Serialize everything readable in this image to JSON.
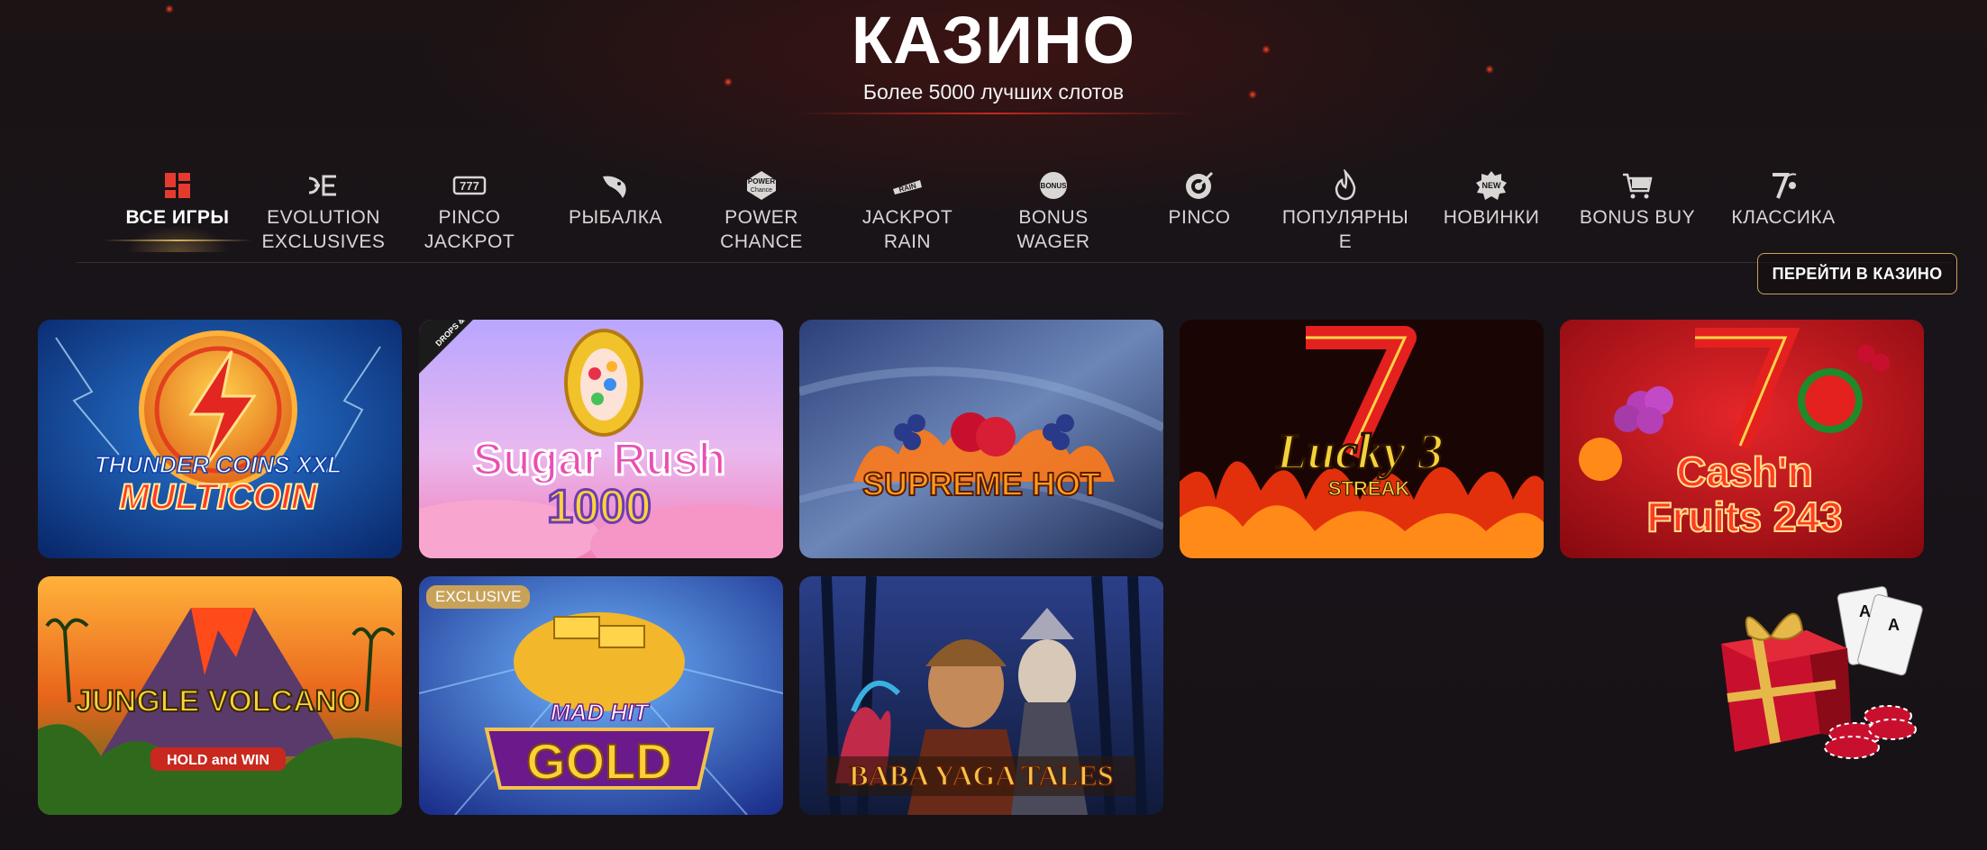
{
  "header": {
    "title": "КАЗИНО",
    "subtitle": "Более 5000 лучших слотов"
  },
  "tabs": [
    {
      "label": "ВСЕ ИГРЫ",
      "icon": "grid-icon",
      "active": true
    },
    {
      "label": "EVOLUTION EXCLUSIVES",
      "icon": "evolution-logo-icon"
    },
    {
      "label": "PINCO JACKPOT",
      "icon": "slot-777-icon"
    },
    {
      "label": "РЫБАЛКА",
      "icon": "fish-icon"
    },
    {
      "label": "POWER CHANCE",
      "icon": "power-chance-icon"
    },
    {
      "label": "JACKPOT RAIN",
      "icon": "rain-icon"
    },
    {
      "label": "BONUS WAGER",
      "icon": "bonus-badge-icon"
    },
    {
      "label": "PINCO",
      "icon": "target-icon"
    },
    {
      "label": "ПОПУЛЯРНЫЕ",
      "icon": "fire-icon"
    },
    {
      "label": "НОВИНКИ",
      "icon": "new-badge-icon"
    },
    {
      "label": "BONUS BUY",
      "icon": "cart-icon"
    },
    {
      "label": "КЛАССИКА",
      "icon": "seven-cherry-icon"
    }
  ],
  "cta": {
    "label": "ПЕРЕЙТИ В КАЗИНО"
  },
  "games": [
    {
      "line1": "THUNDER COINS XXL",
      "line2": "MULTICOIN",
      "badge": ""
    },
    {
      "line1": "Sugar Rush",
      "line2": "1000",
      "badge": "DROPS & WINS"
    },
    {
      "line1": "SUPREME HOT",
      "line2": "",
      "badge": ""
    },
    {
      "line1": "Lucky 3",
      "line2": "STREAK",
      "badge": ""
    },
    {
      "line1": "Cash'n",
      "line2": "Fruits 243",
      "badge": ""
    },
    {
      "line1": "JUNGLE VOLCANO",
      "line2": "HOLD and WIN",
      "badge": ""
    },
    {
      "line1": "MAD HIT",
      "line2": "GOLD",
      "badge": "EXCLUSIVE"
    },
    {
      "line1": "BABA YAGA TALES",
      "line2": "",
      "badge": ""
    }
  ],
  "colors": {
    "accent_gold": "#c9a35a",
    "title_line_red": "#c8281e",
    "background": "#1a1415"
  }
}
